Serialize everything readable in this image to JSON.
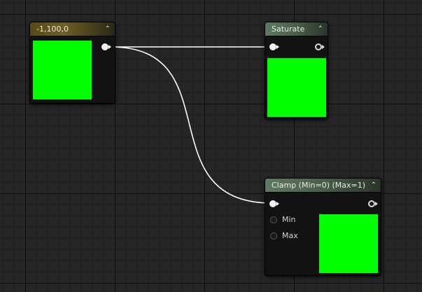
{
  "nodes": {
    "constant": {
      "title": "-1,100,0"
    },
    "saturate": {
      "title": "Saturate"
    },
    "clamp": {
      "title": "Clamp (Min=0) (Max=1)",
      "pins": {
        "min_label": "Min",
        "max_label": "Max"
      }
    }
  },
  "colors": {
    "preview": "#00ff00",
    "wire": "#ffffff",
    "constant_header": "#6e5f24",
    "function_header": "#5f7a5f"
  },
  "icons": {
    "collapse": "chevron-up-icon",
    "pin_connected": "filled-circle-pin-icon",
    "pin_unconnected": "hollow-circle-pin-icon"
  }
}
